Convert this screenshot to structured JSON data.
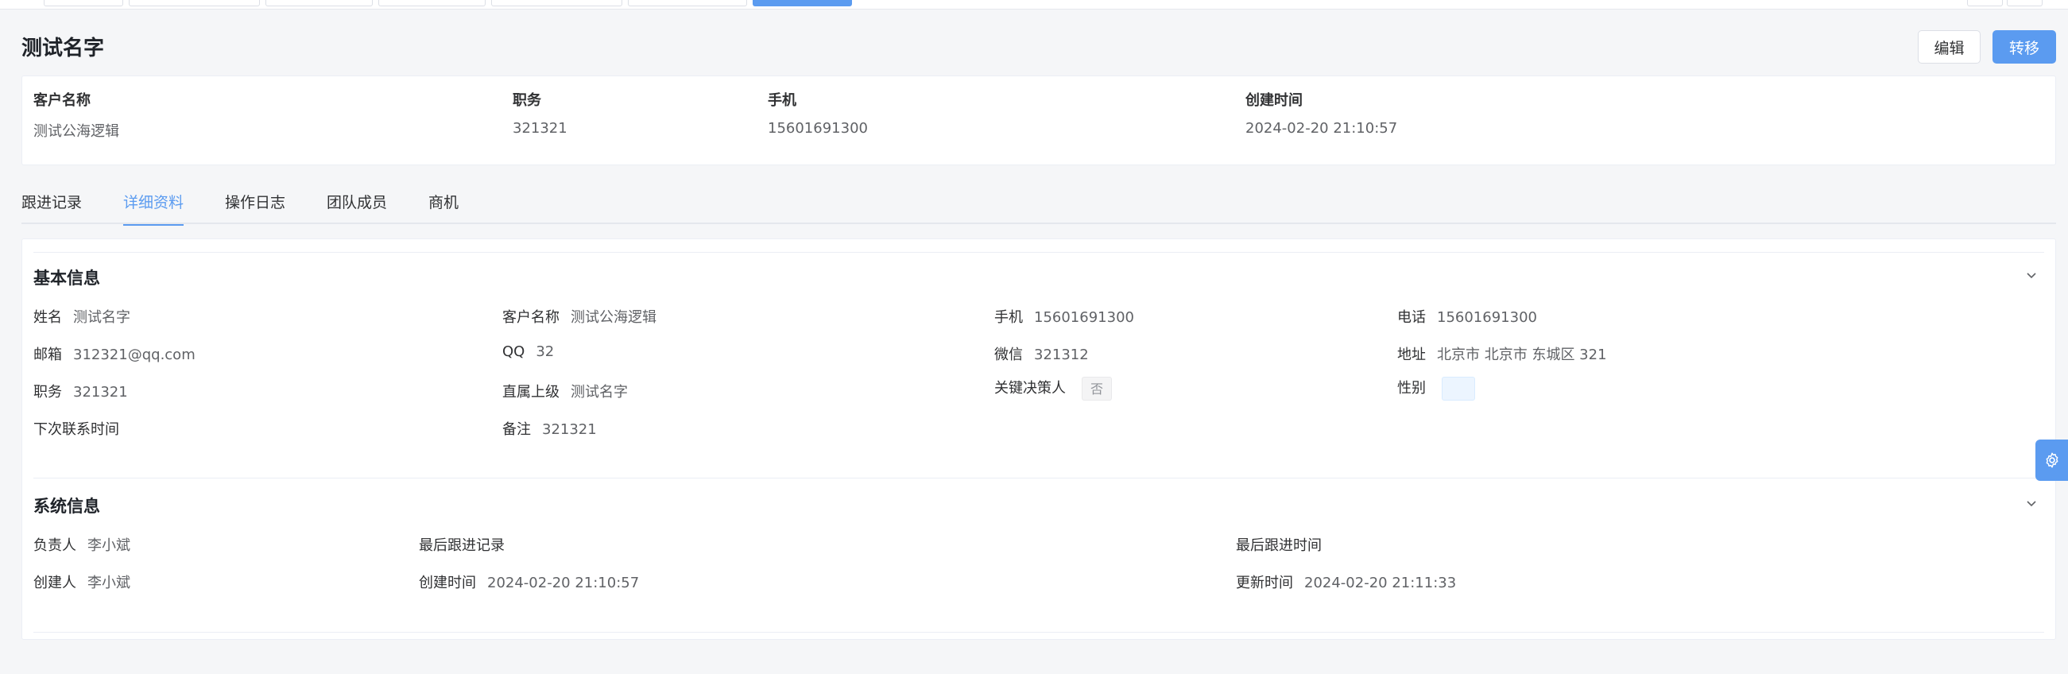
{
  "header": {
    "title": "测试名字",
    "edit_label": "编辑",
    "transfer_label": "转移"
  },
  "summary": {
    "items": [
      {
        "label": "客户名称",
        "value": "测试公海逻辑"
      },
      {
        "label": "职务",
        "value": "321321"
      },
      {
        "label": "手机",
        "value": "15601691300"
      },
      {
        "label": "创建时间",
        "value": "2024-02-20 21:10:57"
      }
    ]
  },
  "tabs": [
    {
      "label": "跟进记录"
    },
    {
      "label": "详细资料"
    },
    {
      "label": "操作日志"
    },
    {
      "label": "团队成员"
    },
    {
      "label": "商机"
    }
  ],
  "basic": {
    "title": "基本信息",
    "name": {
      "label": "姓名",
      "value": "测试名字"
    },
    "customer": {
      "label": "客户名称",
      "value": "测试公海逻辑"
    },
    "mobile": {
      "label": "手机",
      "value": "15601691300"
    },
    "phone": {
      "label": "电话",
      "value": "15601691300"
    },
    "email": {
      "label": "邮箱",
      "value": "312321@qq.com"
    },
    "qq": {
      "label": "QQ",
      "value": "32"
    },
    "wechat": {
      "label": "微信",
      "value": "321312"
    },
    "address": {
      "label": "地址",
      "value": "北京市 北京市 东城区 321"
    },
    "position": {
      "label": "职务",
      "value": "321321"
    },
    "superior": {
      "label": "直属上级",
      "value": "测试名字"
    },
    "decision_maker": {
      "label": "关键决策人",
      "value": "否"
    },
    "gender": {
      "label": "性别"
    },
    "next_contact": {
      "label": "下次联系时间"
    },
    "remark": {
      "label": "备注",
      "value": "321321"
    }
  },
  "system": {
    "title": "系统信息",
    "owner": {
      "label": "负责人",
      "value": "李小斌"
    },
    "last_record": {
      "label": "最后跟进记录"
    },
    "last_time": {
      "label": "最后跟进时间"
    },
    "creator": {
      "label": "创建人",
      "value": "李小斌"
    },
    "created_at": {
      "label": "创建时间",
      "value": "2024-02-20 21:10:57"
    },
    "updated_at": {
      "label": "更新时间",
      "value": "2024-02-20 21:11:33"
    }
  },
  "icons": {
    "collapse": "chevron-down-icon",
    "settings": "gear-icon"
  },
  "colors": {
    "accent": "#5b9bf0",
    "background": "#f5f6f8"
  }
}
